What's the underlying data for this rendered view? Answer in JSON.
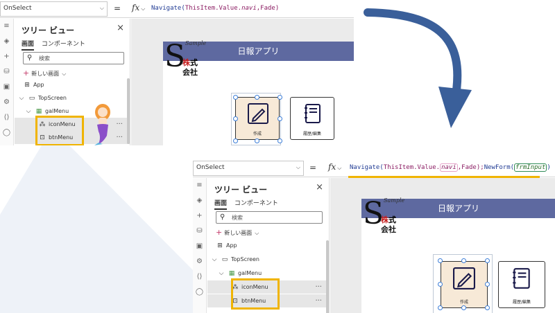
{
  "top": {
    "formula": {
      "property": "OnSelect",
      "equals": "=",
      "fx": "fx",
      "fn": "Navigate(",
      "arg1": "ThisItem.Value.",
      "arg1b": "navi",
      "arg2": ",Fade)"
    },
    "tree": {
      "title": "ツリー ビュー",
      "close": "×",
      "tabs": [
        "画面",
        "コンポーネント"
      ],
      "search_placeholder": "検索",
      "new_screen": "新しい画面",
      "items": [
        "App",
        "TopScreen",
        "galMenu",
        "iconMenu",
        "btnMenu"
      ],
      "more": "···"
    },
    "app": {
      "title": "日報アプリ",
      "logo_sample": "Sample",
      "logo_kabu_red": "株",
      "logo_kabu_black": "式",
      "logo_kaisha": "会社",
      "logo_s": "S",
      "tiles": [
        "作成",
        "履歴/編集"
      ]
    }
  },
  "bottom": {
    "formula": {
      "property": "OnSelect",
      "equals": "=",
      "fx": "fx",
      "fn": "Navigate(",
      "arg1": "ThisItem.Value.",
      "arg1b": "navi",
      "arg2": ",Fade);",
      "fn2": "NewForm(",
      "arg3": "frmInput",
      "close": ")"
    },
    "tree": {
      "title": "ツリー ビュー",
      "close": "×",
      "tabs": [
        "画面",
        "コンポーネント"
      ],
      "search_placeholder": "検索",
      "new_screen": "新しい画面",
      "items": [
        "App",
        "TopScreen",
        "galMenu",
        "iconMenu",
        "btnMenu"
      ],
      "more": "···"
    },
    "app": {
      "title": "日報アプリ",
      "logo_sample": "Sample",
      "logo_kabu_red": "株",
      "logo_kabu_black": "式",
      "logo_kaisha": "会社",
      "logo_s": "S",
      "tiles": [
        "作成",
        "履歴/編集"
      ]
    }
  },
  "colors": {
    "highlight": "#f0b400",
    "title_bar": "#5e69a0",
    "arrow": "#3a5f9a"
  }
}
